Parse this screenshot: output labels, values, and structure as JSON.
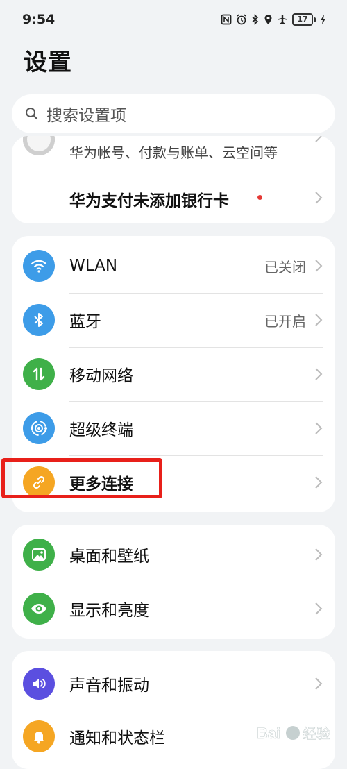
{
  "status_bar": {
    "time": "9:54",
    "battery": "17"
  },
  "header": {
    "title": "设置"
  },
  "search": {
    "placeholder": "搜索设置项"
  },
  "account_card": {
    "subtitle": "华为帐号、付款与账单、云空间等",
    "wallet_label": "华为支付未添加银行卡"
  },
  "connectivity": {
    "items": [
      {
        "label": "WLAN",
        "value": "已关闭",
        "icon": "wifi-icon",
        "color": "#3d9ce8"
      },
      {
        "label": "蓝牙",
        "value": "已开启",
        "icon": "bluetooth-icon",
        "color": "#3d9ce8"
      },
      {
        "label": "移动网络",
        "value": "",
        "icon": "mobile-data-icon",
        "color": "#3fb049"
      },
      {
        "label": "超级终端",
        "value": "",
        "icon": "super-device-icon",
        "color": "#3d9ce8"
      },
      {
        "label": "更多连接",
        "value": "",
        "icon": "link-icon",
        "color": "#f5a623"
      }
    ]
  },
  "display": {
    "items": [
      {
        "label": "桌面和壁纸",
        "icon": "wallpaper-icon",
        "color": "#3fb049"
      },
      {
        "label": "显示和亮度",
        "icon": "eye-icon",
        "color": "#3fb049"
      }
    ]
  },
  "sound": {
    "items": [
      {
        "label": "声音和振动",
        "icon": "speaker-icon",
        "color": "#5b4fe0"
      },
      {
        "label": "通知和状态栏",
        "icon": "bell-icon",
        "color": "#f5a623"
      }
    ]
  },
  "watermark": {
    "text": "Bai经验"
  }
}
